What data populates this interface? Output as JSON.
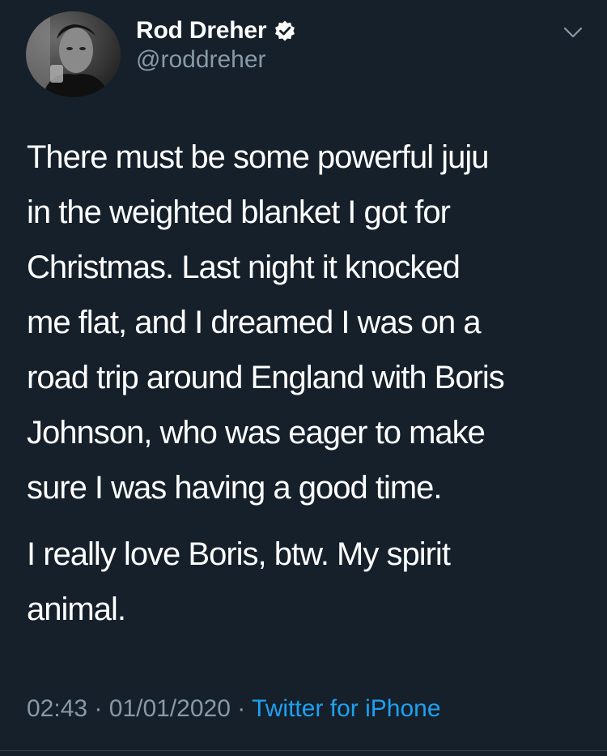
{
  "user": {
    "display_name": "Rod Dreher",
    "handle": "@roddreher",
    "verified": true
  },
  "tweet": {
    "paragraph_1": "There must be some powerful juju\nin the weighted blanket I got for\nChristmas. Last night it knocked\nme flat, and I dreamed I was on a\nroad trip around England with Boris\nJohnson, who was eager to make\nsure I was having a good time.",
    "paragraph_2": "I really love Boris, btw. My spirit\nanimal."
  },
  "meta": {
    "time": "02:43",
    "separator": "·",
    "date": "01/01/2020",
    "source": "Twitter for iPhone"
  },
  "icons": {
    "verified": "verified-badge-icon",
    "menu": "chevron-down-icon"
  },
  "colors": {
    "background": "#15202b",
    "text": "#ffffff",
    "secondary_text": "#8899a6",
    "accent": "#1da1f2"
  }
}
